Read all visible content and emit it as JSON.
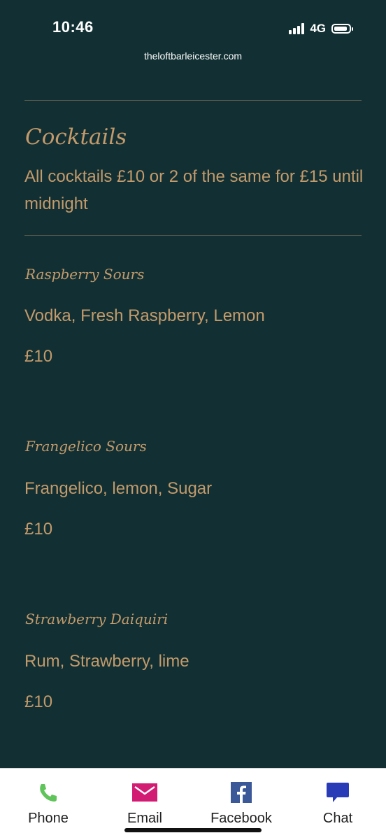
{
  "status_bar": {
    "time": "10:46",
    "network": "4G"
  },
  "browser": {
    "url": "theloftbarleicester.com"
  },
  "section": {
    "title": "Cocktails",
    "description": "All cocktails £10 or 2 of the same for £15 until midnight"
  },
  "menu_items": [
    {
      "name": "Raspberry Sours",
      "description": "Vodka, Fresh Raspberry, Lemon",
      "price": "£10"
    },
    {
      "name": "Frangelico Sours",
      "description": "Frangelico, lemon, Sugar",
      "price": "£10"
    },
    {
      "name": "Strawberry Daiquiri",
      "description": "Rum, Strawberry, lime",
      "price": "£10"
    }
  ],
  "bottom_nav": [
    {
      "label": "Phone",
      "icon": "phone-icon",
      "color": "#5fc45a"
    },
    {
      "label": "Email",
      "icon": "email-icon",
      "color": "#d21b73"
    },
    {
      "label": "Facebook",
      "icon": "facebook-icon",
      "color": "#3b5998"
    },
    {
      "label": "Chat",
      "icon": "chat-icon",
      "color": "#2a3bb8"
    }
  ],
  "colors": {
    "background": "#123033",
    "accent": "#c39a6b",
    "divider": "#5d5e4c"
  }
}
